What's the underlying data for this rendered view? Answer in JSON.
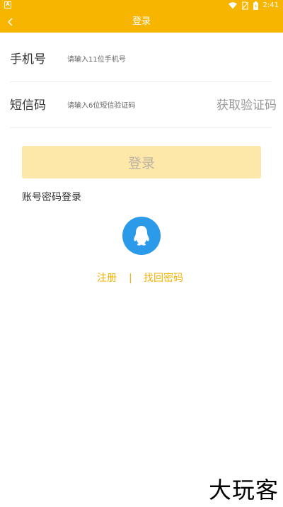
{
  "status_bar": {
    "left_badge": "A",
    "time": "2:41"
  },
  "app_bar": {
    "title": "登录"
  },
  "form": {
    "phone_label": "手机号",
    "phone_placeholder": "请输入11位手机号",
    "phone_value": "",
    "code_label": "短信码",
    "code_placeholder": "请输入6位短信验证码",
    "code_value": "",
    "get_code_label": "获取验证码"
  },
  "login_button_label": "登录",
  "account_login_label": "账号密码登录",
  "links": {
    "register": "注册",
    "separator": "|",
    "forgot_password": "找回密码"
  },
  "watermark": "大玩客",
  "colors": {
    "primary": "#f7b500",
    "login_disabled_bg": "#fde7a9",
    "qq_blue": "#2b9ae8",
    "link": "#f2b200"
  }
}
